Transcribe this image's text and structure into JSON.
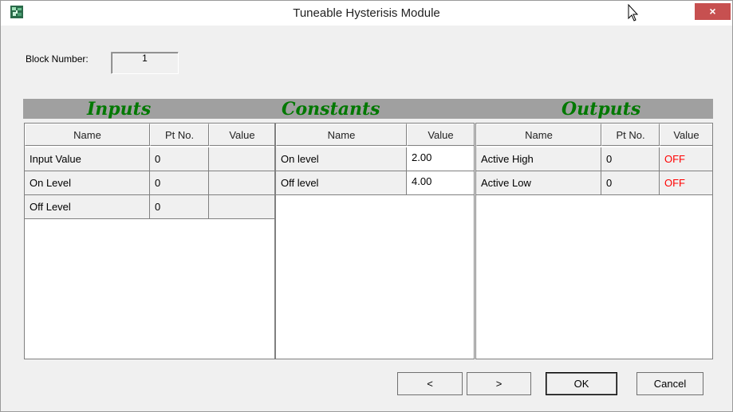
{
  "window": {
    "title": "Tuneable Hysterisis Module",
    "close_glyph": "×"
  },
  "block": {
    "label": "Block Number:",
    "value": "1"
  },
  "sections": {
    "inputs": "Inputs",
    "constants": "Constants",
    "outputs": "Outputs"
  },
  "inputs": {
    "headers": [
      "Name",
      "Pt No.",
      "Value"
    ],
    "rows": [
      {
        "name": "Input Value",
        "pt": "0",
        "value": ""
      },
      {
        "name": "On Level",
        "pt": "0",
        "value": ""
      },
      {
        "name": "Off Level",
        "pt": "0",
        "value": ""
      }
    ]
  },
  "constants": {
    "headers": [
      "Name",
      "Value"
    ],
    "rows": [
      {
        "name": "On level",
        "value": "2.00"
      },
      {
        "name": "Off level",
        "value": "4.00"
      }
    ]
  },
  "outputs": {
    "headers": [
      "Name",
      "Pt No.",
      "Value"
    ],
    "rows": [
      {
        "name": "Active High",
        "pt": "0",
        "value": "OFF"
      },
      {
        "name": "Active Low",
        "pt": "0",
        "value": "OFF"
      }
    ]
  },
  "buttons": {
    "prev": "<",
    "next": ">",
    "ok": "OK",
    "cancel": "Cancel"
  },
  "colors": {
    "section_title": "#007800",
    "off_status": "#ff0000",
    "close_button": "#c75050"
  }
}
